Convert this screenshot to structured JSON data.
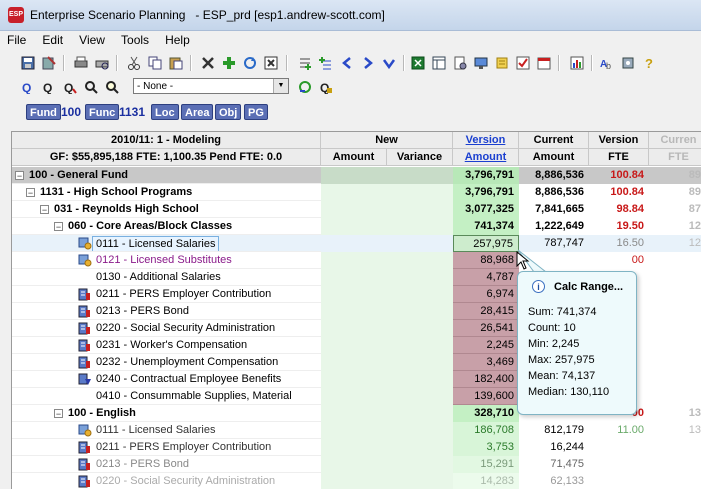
{
  "window": {
    "title": "Enterprise Scenario Planning   - ESP_prd [esp1.andrew-scott.com]",
    "app_icon_text": "ESP"
  },
  "menu": [
    "File",
    "Edit",
    "View",
    "Tools",
    "Help"
  ],
  "toolbar": {
    "scenario_combo": "- None -"
  },
  "dimension_bar": [
    {
      "label": "Fund",
      "value": "100"
    },
    {
      "label": "Func",
      "value": "1131"
    },
    {
      "label": "Loc",
      "value": ""
    },
    {
      "label": "Area",
      "value": ""
    },
    {
      "label": "Obj",
      "value": ""
    },
    {
      "label": "PG",
      "value": ""
    }
  ],
  "grid": {
    "header_top": {
      "title": "2010/11: 1 - Modeling",
      "new": "New",
      "version": "Version",
      "current": "Current",
      "version2": "Version",
      "current2": "Curren"
    },
    "header_bottom": {
      "summary": "GF: $55,895,188  FTE: 1,100.35  Pend FTE: 0.0",
      "amount": "Amount",
      "variance": "Variance",
      "version_amount": "Amount",
      "current_amount": "Amount",
      "fte": "FTE",
      "fte2": "FTE"
    },
    "rows": [
      {
        "label": "100 - General Fund",
        "level": 0,
        "toggle": "−",
        "bold": true,
        "icon": "",
        "version": "3,796,791",
        "current": "8,886,536",
        "fte": "100.84",
        "fte2": "89.",
        "style": "total"
      },
      {
        "label": "1131 - High School Programs",
        "level": 1,
        "toggle": "−",
        "bold": true,
        "icon": "",
        "version": "3,796,791",
        "current": "8,886,536",
        "fte": "100.84",
        "fte2": "89.",
        "style": "sub"
      },
      {
        "label": "031 - Reynolds High School",
        "level": 2,
        "toggle": "−",
        "bold": true,
        "icon": "",
        "version": "3,077,325",
        "current": "7,841,665",
        "fte": "98.84",
        "fte2": "87.",
        "style": "sub"
      },
      {
        "label": "060 - Core Areas/Block Classes",
        "level": 3,
        "toggle": "−",
        "bold": true,
        "icon": "",
        "version": "741,374",
        "current": "1,222,649",
        "fte": "19.50",
        "fte2": "12.",
        "style": "sub"
      },
      {
        "label": "0111 - Licensed Salaries",
        "level": 4,
        "toggle": "",
        "bold": false,
        "icon": "people",
        "version": "257,975",
        "current": "787,747",
        "fte": "16.50",
        "fte2": "12.",
        "style": "selected"
      },
      {
        "label": "0121 - Licensed Substitutes",
        "level": 4,
        "toggle": "",
        "bold": false,
        "icon": "people",
        "version": "88,968",
        "current": "",
        "fte": "00",
        "fte2": "",
        "style": "red",
        "color": "#8a1a8a"
      },
      {
        "label": "0130 - Additional Salaries",
        "level": 4,
        "toggle": "",
        "bold": false,
        "icon": "",
        "version": "4,787",
        "current": "",
        "fte": "",
        "fte2": "",
        "style": "red"
      },
      {
        "label": "0211 - PERS Employer Contribution",
        "level": 4,
        "toggle": "",
        "bold": false,
        "icon": "calc",
        "version": "6,974",
        "current": "",
        "fte": "",
        "fte2": "",
        "style": "red"
      },
      {
        "label": "0213 - PERS Bond",
        "level": 4,
        "toggle": "",
        "bold": false,
        "icon": "calc",
        "version": "28,415",
        "current": "",
        "fte": "",
        "fte2": "",
        "style": "red"
      },
      {
        "label": "0220 - Social Security Administration",
        "level": 4,
        "toggle": "",
        "bold": false,
        "icon": "calc",
        "version": "26,541",
        "current": "",
        "fte": "",
        "fte2": "",
        "style": "red"
      },
      {
        "label": "0231 - Worker's Compensation",
        "level": 4,
        "toggle": "",
        "bold": false,
        "icon": "calc",
        "version": "2,245",
        "current": "",
        "fte": "",
        "fte2": "",
        "style": "red"
      },
      {
        "label": "0232 - Unemployment Compensation",
        "level": 4,
        "toggle": "",
        "bold": false,
        "icon": "calc",
        "version": "3,469",
        "current": "",
        "fte": "",
        "fte2": "",
        "style": "red"
      },
      {
        "label": "0240 - Contractual Employee Benefits",
        "level": 4,
        "toggle": "",
        "bold": false,
        "icon": "calcdown",
        "version": "182,400",
        "current": "",
        "fte": "",
        "fte2": "",
        "style": "red"
      },
      {
        "label": "0410 - Consummable Supplies, Material",
        "level": 4,
        "toggle": "",
        "bold": false,
        "icon": "",
        "version": "139,600",
        "current": "",
        "fte": "",
        "fte2": "",
        "style": "red"
      },
      {
        "label": "100 - English",
        "level": 3,
        "toggle": "−",
        "bold": true,
        "icon": "",
        "version": "328,710",
        "current": "",
        "fte": "00",
        "fte2": "13.",
        "style": "sub"
      },
      {
        "label": "0111 - Licensed Salaries",
        "level": 4,
        "toggle": "",
        "bold": false,
        "icon": "people",
        "version": "186,708",
        "current": "812,179",
        "fte": "11.00",
        "fte2": "13.",
        "style": "fade"
      },
      {
        "label": "0211 - PERS Employer Contribution",
        "level": 4,
        "toggle": "",
        "bold": false,
        "icon": "calc",
        "version": "3,753",
        "current": "16,244",
        "fte": "",
        "fte2": "",
        "style": "fade"
      },
      {
        "label": "0213 - PERS Bond",
        "level": 4,
        "toggle": "",
        "bold": false,
        "icon": "calc",
        "version": "15,291",
        "current": "71,475",
        "fte": "",
        "fte2": "",
        "style": "fade2"
      },
      {
        "label": "0220 - Social Security Administration",
        "level": 4,
        "toggle": "",
        "bold": false,
        "icon": "calc",
        "version": "14,283",
        "current": "62,133",
        "fte": "",
        "fte2": "",
        "style": "fade3"
      }
    ]
  },
  "tooltip": {
    "title": "Calc Range...",
    "lines": [
      "Sum: 741,374",
      "Count: 10",
      "Min: 2,245",
      "Max: 257,975",
      "Mean: 74,137",
      "Median: 130,110"
    ]
  },
  "colors": {
    "version_bg": "#d6f5d6",
    "red_bg": "#c8a0a8",
    "total_bg": "#c8c8c8",
    "fte_red": "#c81818"
  }
}
